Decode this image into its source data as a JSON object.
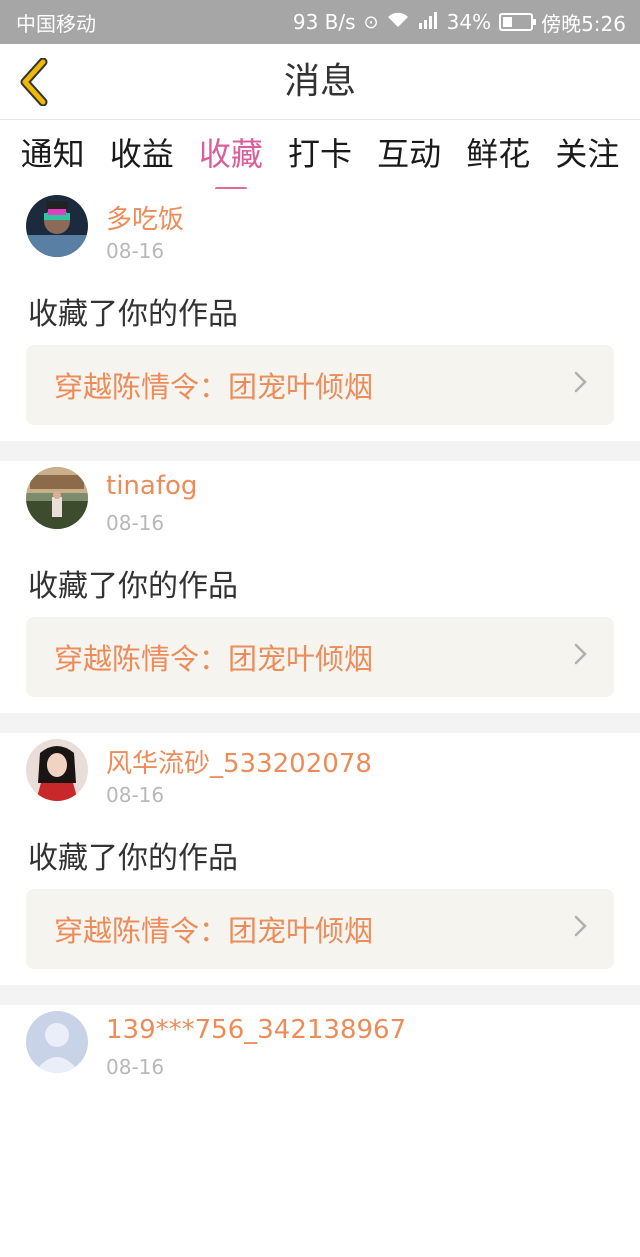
{
  "status_bar": {
    "carrier": "中国移动",
    "speed": "93 B/s",
    "network": "4G",
    "battery": "34%",
    "battery_level": 0.34,
    "time": "傍晚5:26"
  },
  "nav": {
    "title": "消息",
    "back_icon": "chevron-left-icon",
    "accent": "#f0a000"
  },
  "tabs": [
    {
      "label": "通知"
    },
    {
      "label": "收益"
    },
    {
      "label": "收藏",
      "active": true
    },
    {
      "label": "打卡"
    },
    {
      "label": "互动"
    },
    {
      "label": "鲜花"
    },
    {
      "label": "关注"
    }
  ],
  "items": [
    {
      "user": "多吃饭",
      "date": "08-16",
      "action": "收藏了你的作品",
      "work": "穿越陈情令：团宠叶倾烟",
      "avatar_palette": "night-portrait"
    },
    {
      "user": "tinafog",
      "date": "08-16",
      "action": "收藏了你的作品",
      "work": "穿越陈情令：团宠叶倾烟",
      "avatar_palette": "palace-photo"
    },
    {
      "user": "风华流砂_533202078",
      "date": "08-16",
      "action": "收藏了你的作品",
      "work": "穿越陈情令：团宠叶倾烟",
      "avatar_palette": "red-costume"
    },
    {
      "user": "139***756_342138967",
      "date": "08-16",
      "action": "",
      "work": "",
      "avatar_palette": "default-gray"
    }
  ],
  "colors": {
    "username": "#ec8c5b",
    "active_tab": "#d9609a",
    "work_bg": "#f5f4ee"
  }
}
